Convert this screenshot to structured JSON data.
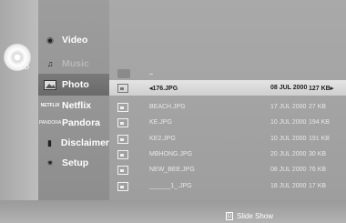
{
  "menu": {
    "items": [
      {
        "label": "Video",
        "icon": "video-disc-icon",
        "state": "normal"
      },
      {
        "label": "Music",
        "icon": "music-note-icon",
        "state": "dim"
      },
      {
        "label": "Photo",
        "icon": "photo-icon",
        "state": "selected"
      },
      {
        "label": "Netflix",
        "icon": "netflix-logo-icon",
        "state": "normal"
      },
      {
        "label": "Pandora",
        "icon": "pandora-logo-icon",
        "state": "normal"
      },
      {
        "label": "Disclaimer",
        "icon": "disclaimer-icon",
        "state": "normal"
      },
      {
        "label": "Setup",
        "icon": "gear-icon",
        "state": "normal"
      }
    ]
  },
  "source": {
    "label": "CD"
  },
  "file_list": {
    "parent": {
      "name": ".."
    },
    "rows": [
      {
        "name": "◂176.JPG",
        "date": "08 JUL 2000",
        "size": "127 KB▸",
        "selected": true
      },
      {
        "name": "BEACH.JPG",
        "date": "17 JUL 2000",
        "size": "27 KB",
        "selected": false
      },
      {
        "name": "KE.JPG",
        "date": "10 JUL 2000",
        "size": "194 KB",
        "selected": false
      },
      {
        "name": "KE2.JPG",
        "date": "10 JUL 2000",
        "size": "191 KB",
        "selected": false
      },
      {
        "name": "MBHONG.JPG",
        "date": "20 JUL 2000",
        "size": "30 KB",
        "selected": false
      },
      {
        "name": "NEW_BEE.JPG",
        "date": "08 JUL 2000",
        "size": "76 KB",
        "selected": false
      },
      {
        "name": "______1_.JPG",
        "date": "18 JUL 2000",
        "size": "17 KB",
        "selected": false
      }
    ]
  },
  "footer": {
    "key": "D",
    "hint": "Slide Show"
  }
}
